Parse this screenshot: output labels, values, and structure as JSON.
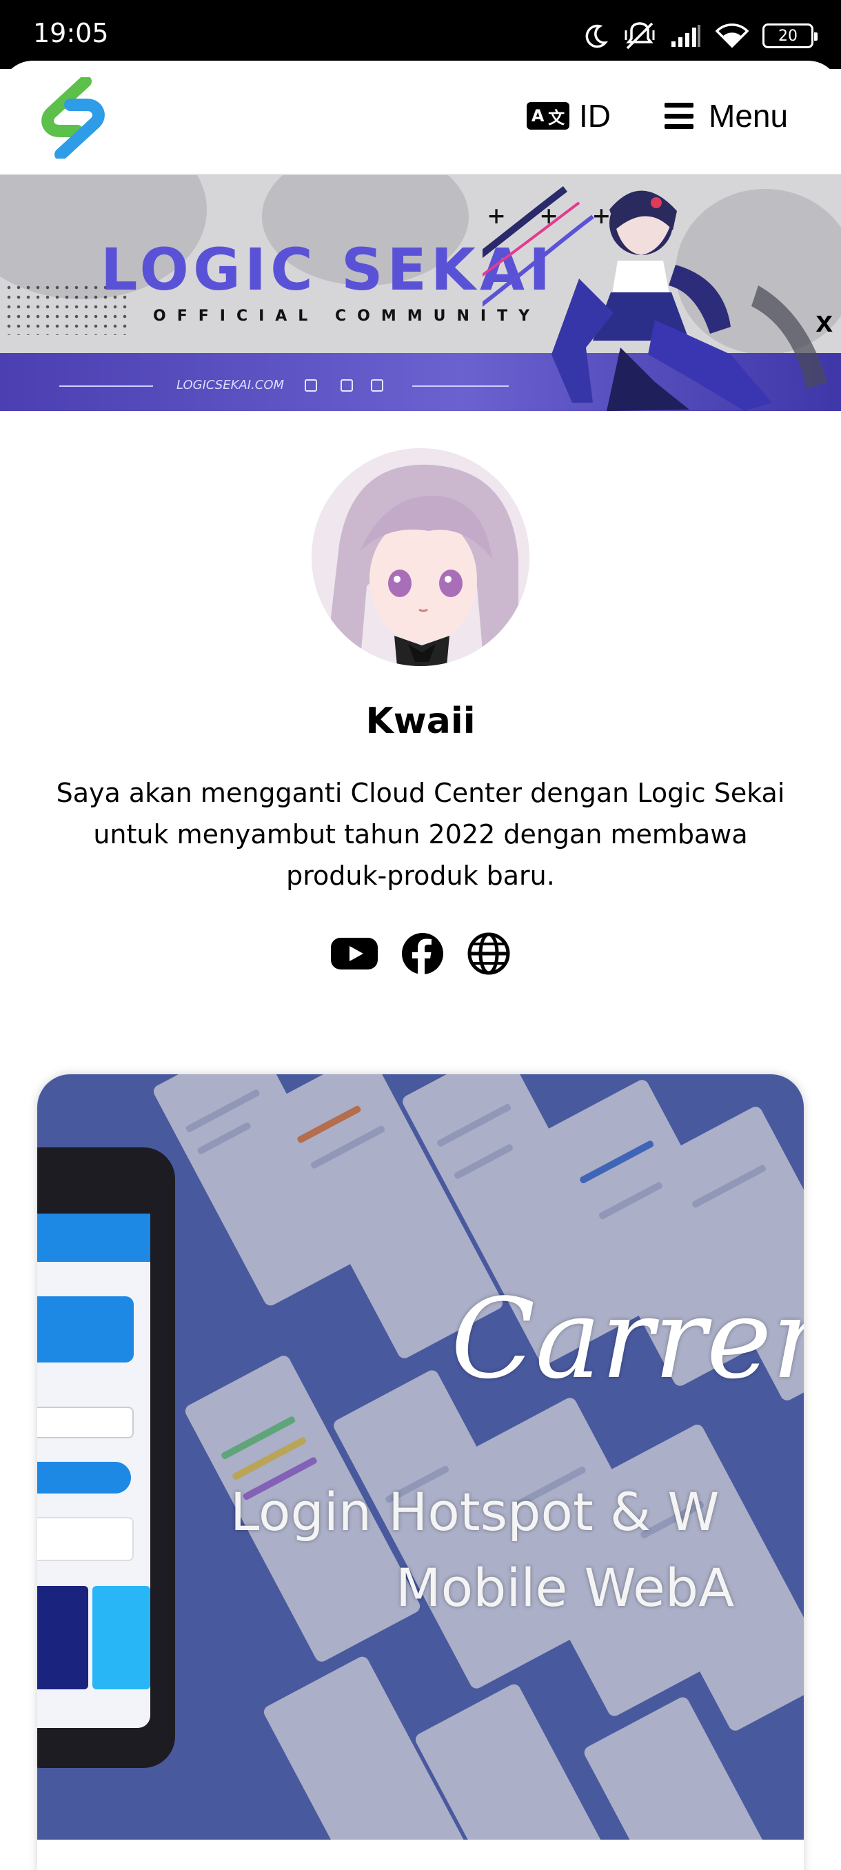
{
  "status_bar": {
    "time": "19:05",
    "battery": "20",
    "icons": [
      "moon-icon",
      "mute-vibrate-icon",
      "signal-icon",
      "wifi-icon",
      "battery-icon"
    ]
  },
  "header": {
    "language_label": "ID",
    "language_icon": "translate-icon",
    "menu_label": "Menu",
    "accent_green": "#5cc04a",
    "accent_blue": "#2e9ce6"
  },
  "banner": {
    "brand": "LOGIC SEKAI",
    "subtitle": "OFFICIAL COMMUNITY",
    "url": "LOGICSEKAI.COM",
    "decor": "+ + +",
    "close_label": "x",
    "accent": "#5a52d6"
  },
  "profile": {
    "name": "Kwaii",
    "bio": "Saya akan mengganti Cloud Center dengan Logic Sekai untuk menyambut tahun 2022 dengan membawa produk-produk baru.",
    "socials": [
      "youtube-icon",
      "facebook-icon",
      "globe-icon"
    ]
  },
  "card": {
    "title": "Carrera",
    "subtitle_line1": "Login Hotspot & W",
    "subtitle_line2": "Mobile WebA"
  }
}
